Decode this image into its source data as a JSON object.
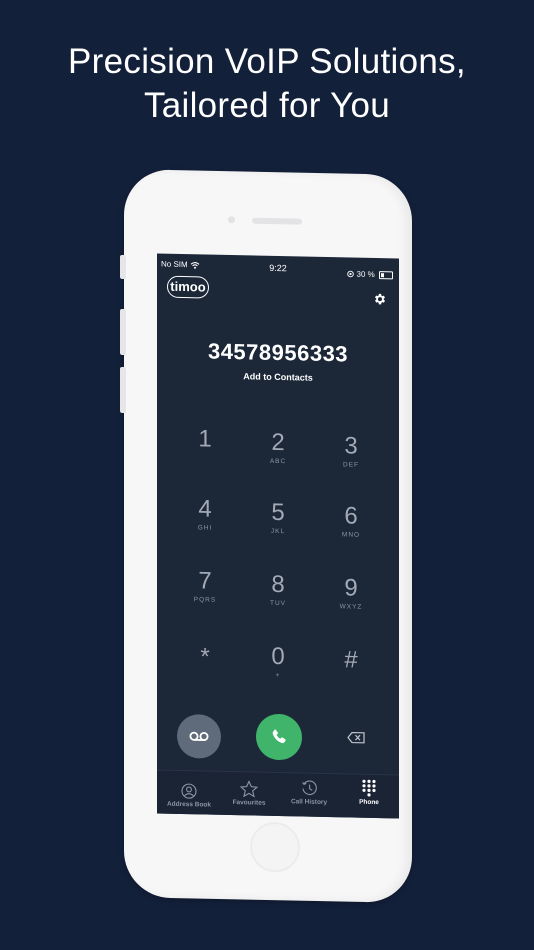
{
  "headline": {
    "line1": "Precision VoIP Solutions,",
    "line2": "Tailored for You"
  },
  "status_bar": {
    "carrier": "No SIM",
    "time": "9:22",
    "battery": "30 %"
  },
  "app": {
    "logo": "timoo",
    "dialed_number": "34578956333",
    "add_contact": "Add to Contacts"
  },
  "keypad": [
    {
      "digit": "1",
      "letters": ""
    },
    {
      "digit": "2",
      "letters": "ABC"
    },
    {
      "digit": "3",
      "letters": "DEF"
    },
    {
      "digit": "4",
      "letters": "GHI"
    },
    {
      "digit": "5",
      "letters": "JKL"
    },
    {
      "digit": "6",
      "letters": "MNO"
    },
    {
      "digit": "7",
      "letters": "PQRS"
    },
    {
      "digit": "8",
      "letters": "TUV"
    },
    {
      "digit": "9",
      "letters": "WXYZ"
    },
    {
      "digit": "*",
      "letters": ""
    },
    {
      "digit": "0",
      "letters": "+"
    },
    {
      "digit": "#",
      "letters": ""
    }
  ],
  "tabs": [
    {
      "label": "Address Book",
      "icon": "person-circle-icon"
    },
    {
      "label": "Favourites",
      "icon": "star-icon"
    },
    {
      "label": "Call History",
      "icon": "clock-history-icon"
    },
    {
      "label": "Phone",
      "icon": "dialpad-icon"
    }
  ],
  "colors": {
    "background": "#13203a",
    "screen": "#1c2738",
    "call_button": "#3fb46a",
    "voicemail_button": "#5f6b7b"
  }
}
